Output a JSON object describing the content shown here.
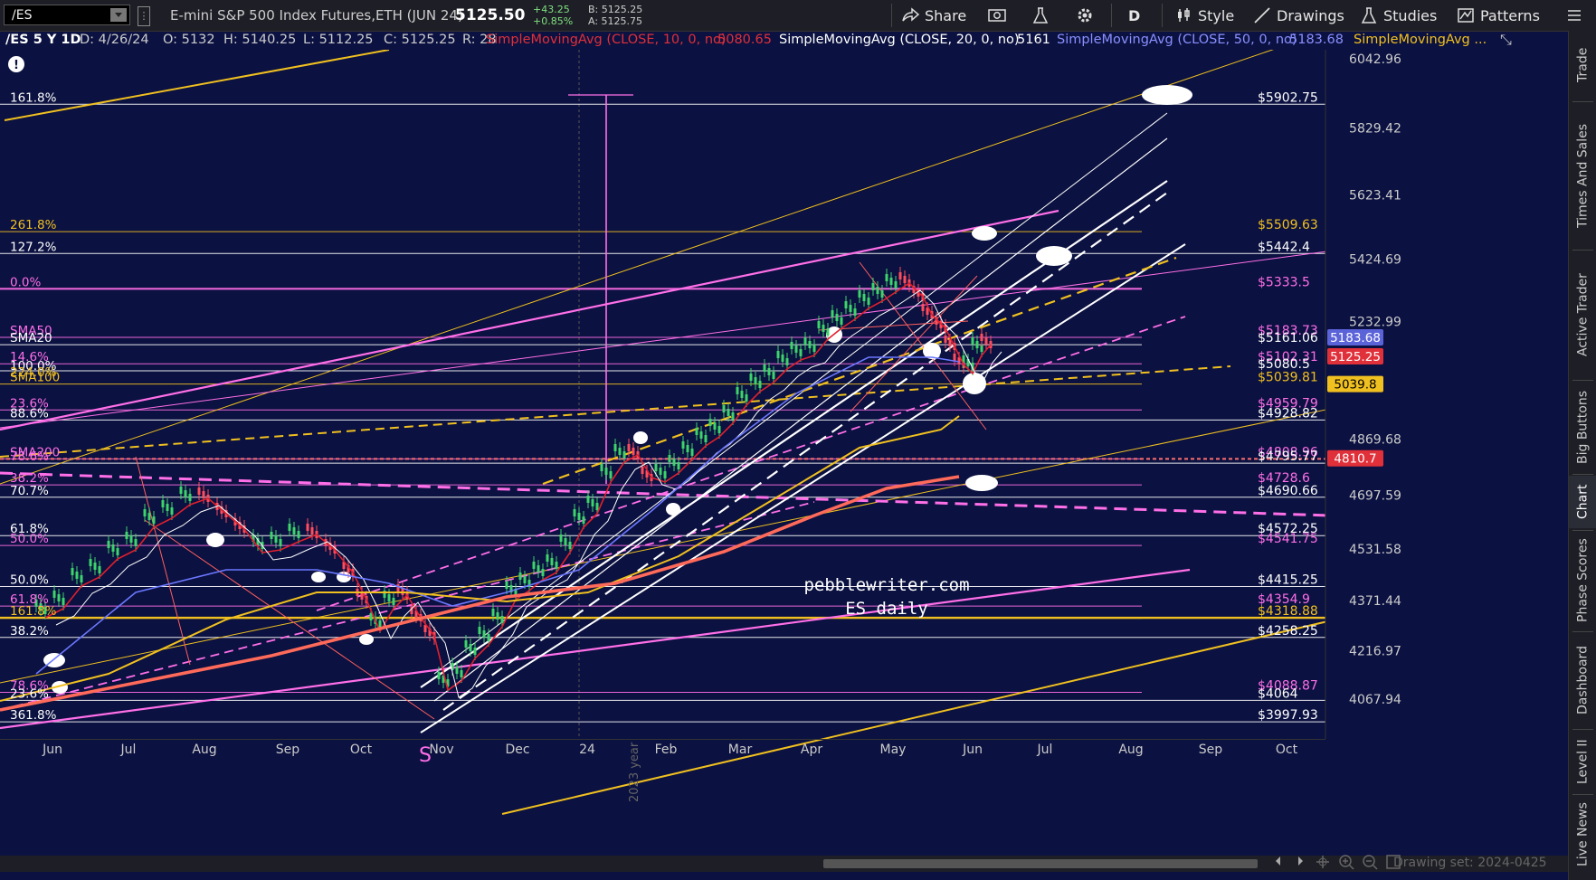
{
  "toolbar": {
    "symbol": "/ES",
    "description": "E-mini S&P 500 Index Futures,ETH (JUN 24)",
    "price": "5125.50",
    "change": "+43.25",
    "change_pct": "+0.85%",
    "bid": "B: 5125.25",
    "ask": "A: 5125.75",
    "share_label": "Share",
    "timeframe_label": "D",
    "style_label": "Style",
    "drawings_label": "Drawings",
    "studies_label": "Studies",
    "patterns_label": "Patterns"
  },
  "legend": {
    "symbol_period": "/ES 5 Y 1D",
    "date": "D: 4/26/24",
    "open": "O: 5132",
    "high": "H: 5140.25",
    "low": "L: 5112.25",
    "close": "C: 5125.25",
    "range": "R: 28",
    "sma10_label": "SimpleMovingAvg (CLOSE, 10, 0, no)",
    "sma10_value": "5080.65",
    "sma20_label": "SimpleMovingAvg (CLOSE, 20, 0, no)",
    "sma20_value": "5161",
    "sma50_label": "SimpleMovingAvg (CLOSE, 50, 0, no)",
    "sma50_value": "5183.68",
    "sma100_label": "SimpleMovingAvg ..."
  },
  "colors": {
    "background": "#0b1140",
    "pink": "#ff6fe8",
    "gold": "#f0c020",
    "white": "#ffffff",
    "red": "#ff5a4a",
    "blue": "#6070ff",
    "sma10": "#e0202e",
    "sma50": "#7080ff"
  },
  "chart_data": {
    "type": "line",
    "y_ticks": [
      "6042.96",
      "5829.42",
      "5623.41",
      "5424.69",
      "5232.99",
      "4869.68",
      "4697.59",
      "4531.58",
      "4371.44",
      "4216.97",
      "4067.94"
    ],
    "x_ticks": [
      "Jun",
      "Jul",
      "Aug",
      "Sep",
      "Oct",
      "Nov",
      "Dec",
      "24",
      "Feb",
      "Mar",
      "Apr",
      "May",
      "Jun",
      "Jul",
      "Aug",
      "Sep",
      "Oct"
    ],
    "price_badges": [
      {
        "label": "5183.68",
        "value": 5183.68,
        "color": "#5b63d9"
      },
      {
        "label": "5125.25",
        "value": 5125.25,
        "color": "#e0303a"
      },
      {
        "label": "5039.8",
        "value": 5039.8,
        "color": "#f0c020"
      },
      {
        "label": "4810.7",
        "value": 4810.7,
        "color": "#e0303a"
      }
    ],
    "fib_left": [
      {
        "label": "161.8%",
        "value": 5902.75,
        "color": "#ffffff"
      },
      {
        "label": "261.8%",
        "value": 5509.63,
        "color": "#f0c020"
      },
      {
        "label": "127.2%",
        "value": 5442.4,
        "color": "#ffffff"
      },
      {
        "label": "0.0%",
        "value": 5333.5,
        "color": "#ff6fe8"
      },
      {
        "label": "SMA50",
        "value": 5183.73,
        "color": "#ff6fe8"
      },
      {
        "label": "SMA20",
        "value": 5161.06,
        "color": "#ffffff"
      },
      {
        "label": "14.6%",
        "value": 5102.31,
        "color": "#ff6fe8"
      },
      {
        "label": "100.0%",
        "value": 5075,
        "color": "#ffffff"
      },
      {
        "label": "224.0%",
        "value": 5055,
        "color": "#f0c020"
      },
      {
        "label": "SMA100",
        "value": 5039.81,
        "color": "#f0c020"
      },
      {
        "label": "23.6%",
        "value": 4959.79,
        "color": "#ff6fe8"
      },
      {
        "label": "88.6%",
        "value": 4928.82,
        "color": "#ffffff"
      },
      {
        "label": "SMA200",
        "value": 4808.96,
        "color": "#ff6fe8"
      },
      {
        "label": "78.6%",
        "value": 4795.77,
        "color": "#ff6fe8"
      },
      {
        "label": "38.2%",
        "value": 4728.6,
        "color": "#ff6fe8"
      },
      {
        "label": "70.7%",
        "value": 4690.66,
        "color": "#ffffff"
      },
      {
        "label": "61.8%",
        "value": 4572.25,
        "color": "#ffffff"
      },
      {
        "label": "50.0%",
        "value": 4541.75,
        "color": "#ff6fe8"
      },
      {
        "label": "50.0%",
        "value": 4415.25,
        "color": "#ffffff"
      },
      {
        "label": "61.8%",
        "value": 4354.9,
        "color": "#ff6fe8"
      },
      {
        "label": "161.8%",
        "value": 4318.88,
        "color": "#f0c020"
      },
      {
        "label": "38.2%",
        "value": 4258.25,
        "color": "#ffffff"
      },
      {
        "label": "78.6%",
        "value": 4088.87,
        "color": "#ff6fe8"
      },
      {
        "label": "23.6%",
        "value": 4064,
        "color": "#ffffff"
      },
      {
        "label": "361.8%",
        "value": 3997.93,
        "color": "#ffffff"
      }
    ],
    "levels_right": [
      {
        "label": "$5902.75",
        "value": 5902.75,
        "color": "#ffffff"
      },
      {
        "label": "$5509.63",
        "value": 5509.63,
        "color": "#f0c020"
      },
      {
        "label": "$5442.4",
        "value": 5442.4,
        "color": "#ffffff"
      },
      {
        "label": "$5333.5",
        "value": 5333.5,
        "color": "#ff6fe8"
      },
      {
        "label": "$5183.73",
        "value": 5183.73,
        "color": "#ff6fe8"
      },
      {
        "label": "$5161.06",
        "value": 5161.06,
        "color": "#ffffff"
      },
      {
        "label": "$5102.31",
        "value": 5102.31,
        "color": "#ff6fe8"
      },
      {
        "label": "$5080.5",
        "value": 5080.5,
        "color": "#ffffff"
      },
      {
        "label": "$5039.81",
        "value": 5039.81,
        "color": "#f0c020"
      },
      {
        "label": "$4959.79",
        "value": 4959.79,
        "color": "#ff6fe8"
      },
      {
        "label": "$4928.82",
        "value": 4928.82,
        "color": "#ffffff"
      },
      {
        "label": "$4808.96",
        "value": 4808.96,
        "color": "#ff6fe8"
      },
      {
        "label": "$4795.77",
        "value": 4795.77,
        "color": "#ffffff"
      },
      {
        "label": "$4728.6",
        "value": 4728.6,
        "color": "#ff6fe8"
      },
      {
        "label": "$4690.66",
        "value": 4690.66,
        "color": "#ffffff"
      },
      {
        "label": "$4572.25",
        "value": 4572.25,
        "color": "#ffffff"
      },
      {
        "label": "$4541.75",
        "value": 4541.75,
        "color": "#ff6fe8"
      },
      {
        "label": "$4415.25",
        "value": 4415.25,
        "color": "#ffffff"
      },
      {
        "label": "$4354.9",
        "value": 4354.9,
        "color": "#ff6fe8"
      },
      {
        "label": "$4318.88",
        "value": 4318.88,
        "color": "#f0c020"
      },
      {
        "label": "$4258.25",
        "value": 4258.25,
        "color": "#ffffff"
      },
      {
        "label": "$4088.87",
        "value": 4088.87,
        "color": "#ff6fe8"
      },
      {
        "label": "$4064",
        "value": 4064,
        "color": "#ffffff"
      },
      {
        "label": "$3997.93",
        "value": 3997.93,
        "color": "#ffffff"
      }
    ],
    "watermark_line1": "pebblewriter.com",
    "watermark_line2": "ES daily",
    "s_marker": "S",
    "year_label": "2023 year"
  },
  "side_panel": [
    "Trade",
    "Times And Sales",
    "Active Trader",
    "Big Buttons",
    "Chart",
    "Phase Scores",
    "Dashboard",
    "Level II",
    "Live News"
  ],
  "footer": {
    "drawing_set": "Drawing set: 2024-0425"
  }
}
